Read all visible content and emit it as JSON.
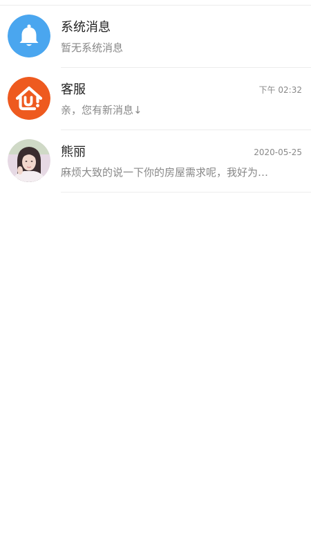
{
  "conversations": [
    {
      "name": "系统消息",
      "time": "",
      "preview": "暂无系统消息",
      "avatar_icon": "bell-icon",
      "avatar_color": "#4aa6ef"
    },
    {
      "name": "客服",
      "time": "下午 02:32",
      "preview": "亲，您有新消息↓",
      "avatar_icon": "house-logo-icon",
      "avatar_color": "#ee5a1f"
    },
    {
      "name": "熊丽",
      "time": "2020-05-25",
      "preview": "麻烦大致的说一下你的房屋需求呢，我好为…",
      "avatar_icon": "user-photo",
      "avatar_color": "#d9c8d2"
    }
  ]
}
